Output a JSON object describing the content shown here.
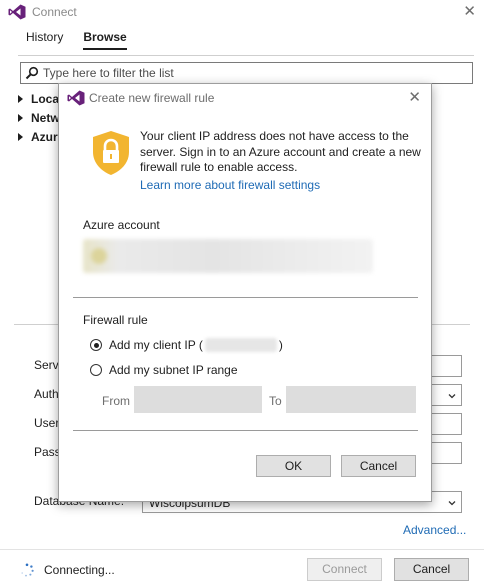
{
  "window": {
    "title": "Connect"
  },
  "tabs": [
    {
      "label": "History"
    },
    {
      "label": "Browse"
    }
  ],
  "filter": {
    "placeholder": "Type here to filter the list"
  },
  "tree": [
    {
      "label": "Loca"
    },
    {
      "label": "Netw"
    },
    {
      "label": "Azur"
    }
  ],
  "form": {
    "server_label": "Serv",
    "auth_label": "Auth",
    "user_label": "User",
    "password_label": "Pass",
    "database_label": "Database Name:",
    "database_value": "WiscolpsumDB"
  },
  "advanced_link": "Advanced...",
  "status": {
    "text": "Connecting..."
  },
  "buttons": {
    "connect": "Connect",
    "cancel": "Cancel"
  },
  "dialog": {
    "title": "Create new firewall rule",
    "message": "Your client IP address does not have access to the server. Sign in to an Azure account and create a new firewall rule to enable access.",
    "learn_link": "Learn more about firewall settings",
    "azure_account_label": "Azure account",
    "firewall_rule_label": "Firewall rule",
    "option_client_ip": "Add my client IP (",
    "option_client_ip_close": ")",
    "option_client_ip_selected": true,
    "option_subnet": "Add my subnet IP range",
    "from_label": "From",
    "to_label": "To",
    "ok": "OK",
    "cancel": "Cancel"
  },
  "colors": {
    "link": "#1f6bb5",
    "vs_purple": "#68217a",
    "lock_shield": "#f2b530"
  }
}
